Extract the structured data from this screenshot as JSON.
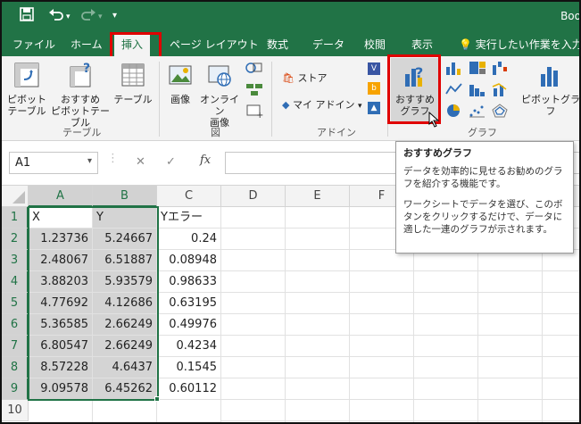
{
  "window": {
    "title_fragment": "Boo"
  },
  "tabs": [
    {
      "label": "ファイル"
    },
    {
      "label": "ホーム"
    },
    {
      "label": "挿入"
    },
    {
      "label": "ページ レイアウト"
    },
    {
      "label": "数式"
    },
    {
      "label": "データ"
    },
    {
      "label": "校閲"
    },
    {
      "label": "表示"
    }
  ],
  "tell_me": "実行したい作業を入力し",
  "ribbon": {
    "pivot_table": "ピボット\nテーブル",
    "recommended_pivot": "おすすめ\nピボットテーブル",
    "table": "テーブル",
    "group_table": "テーブル",
    "image": "画像",
    "online_image": "オンライン\n画像",
    "group_figure": "図",
    "store": "ストア",
    "my_addins": "マイ アドイン",
    "group_addins": "アドイン",
    "recommended_chart": "おすすめ\nグラフ",
    "pivot_chart": "ピボットグラフ",
    "group_charts": "グラフ"
  },
  "formula_bar": {
    "name_box": "A1",
    "fx": "fx",
    "cancel": "✕",
    "enter": "✓"
  },
  "columns": [
    "A",
    "B",
    "C",
    "D",
    "E",
    "F"
  ],
  "rows": [
    "1",
    "2",
    "3",
    "4",
    "5",
    "6",
    "7",
    "8",
    "9",
    "10"
  ],
  "headers": {
    "a": "X",
    "b": "Y",
    "c": "Yエラー"
  },
  "data": [
    [
      "1.23736",
      "5.24667",
      "0.24"
    ],
    [
      "2.48067",
      "6.51887",
      "0.08948"
    ],
    [
      "3.88203",
      "5.93579",
      "0.98633"
    ],
    [
      "4.77692",
      "4.12686",
      "0.63195"
    ],
    [
      "5.36585",
      "2.66249",
      "0.49976"
    ],
    [
      "6.80547",
      "2.66249",
      "0.4234"
    ],
    [
      "8.57228",
      "4.6437",
      "0.1545"
    ],
    [
      "9.09578",
      "6.45262",
      "0.60112"
    ]
  ],
  "tooltip": {
    "title": "おすすめグラフ",
    "p1": "データを効率的に見せるお勧めのグラフを紹介する機能です。",
    "p2": "ワークシートでデータを選び、このボタンをクリックするだけで、データに適した一連のグラフが示されます。"
  },
  "colors": {
    "excel_green": "#217346",
    "highlight_red": "#e00000",
    "selection_gray": "#d4d4d4"
  }
}
